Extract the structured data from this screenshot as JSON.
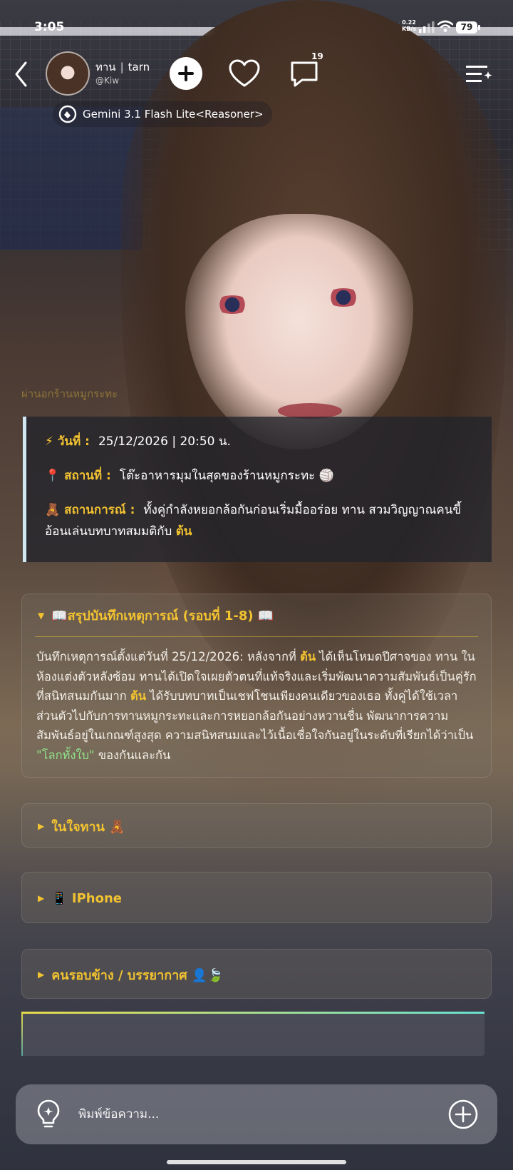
{
  "status_bar": {
    "time": "3:05",
    "net_speed_value": "0.22",
    "net_speed_unit": "KB/s",
    "battery": "79"
  },
  "header": {
    "name_primary": "ทาน",
    "name_secondary": "tarn",
    "handle": "@Kiw",
    "comment_count": "19",
    "model_label": "Gemini 3.1 Flash Lite<Reasoner>"
  },
  "faded_text": "ผ่านอกร้านหมูกระทะ",
  "info_card": {
    "date_label": "⚡ วันที่ :",
    "date_value": "25/12/2026 | 20:50 น.",
    "place_label": "📍 สถานที่ :",
    "place_value": "โต๊ะอาหารมุมในสุดของร้านหมูกระทะ 🏐",
    "situation_label": "🧸 สถานการณ์ :",
    "situation_text_1": "ทั้งคู่กำลังหยอกล้อกันก่อนเริ่มมื้ออร่อย ทาน สวมวิญญาณคนขี้อ้อนเล่นบทบาทสมมติกับ",
    "situation_highlight": "ต้น"
  },
  "summary": {
    "title": "📖สรุปบันทึกเหตุการณ์ (รอบที่ 1-8) 📖",
    "part1": "บันทึกเหตุการณ์ตั้งแต่วันที่ 25/12/2026: หลังจากที่ ",
    "hl1": "ต้น",
    "part2": " ได้เห็นโหมดปีศาจของ ทาน ในห้องแต่งตัวหลังซ้อม ทานได้เปิดใจเผยตัวตนที่แท้จริงและเริ่มพัฒนาความสัมพันธ์เป็นคู่รักที่สนิทสนมกันมาก ",
    "hl2": "ต้น",
    "part3": " ได้รับบทบาทเป็นเชฟโชนเพียงคนเดียวของเธอ ทั้งคู่ได้ใช้เวลาส่วนตัวไปกับการทานหมูกระทะและการหยอกล้อกันอย่างหวานชื่น พัฒนาการความสัมพันธ์อยู่ในเกณฑ์สูงสุด ความสนิทสนมและไว้เนื้อเชื่อใจกันอยู่ในระดับที่เรียกได้ว่าเป็น ",
    "green": "\"โลกทั้งใบ\"",
    "part4": " ของกันและกัน"
  },
  "panels": {
    "inner_heart": "ในใจทาน 🧸",
    "iphone": "📱 IPhone",
    "people": "คนรอบข้าง / บรรยากาศ 👤🍃"
  },
  "input": {
    "placeholder": "พิมพ์ข้อความ..."
  },
  "colors": {
    "accent_gold": "#f2c230",
    "green_quote": "#8fe089",
    "card_border": "#cfe8f2"
  },
  "icons": {
    "back": "chevron-left-icon",
    "add": "plus-icon",
    "like": "heart-icon",
    "comment": "comment-bubble-icon",
    "menu": "list-sparkle-icon",
    "model": "ai-model-icon",
    "hint": "lightbulb-icon",
    "attach": "plus-circle-icon"
  }
}
